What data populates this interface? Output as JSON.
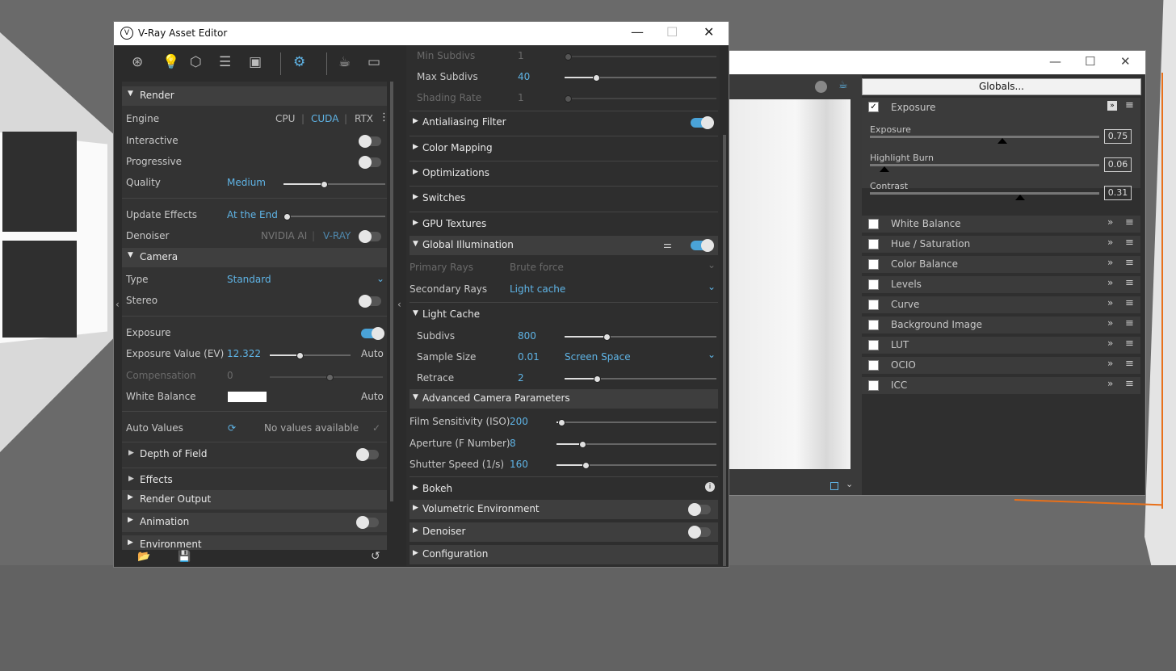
{
  "asset_editor": {
    "title": "V-Ray Asset Editor",
    "render": {
      "header": "Render",
      "engine_label": "Engine",
      "engine_options": [
        "CPU",
        "CUDA",
        "RTX"
      ],
      "interactive_label": "Interactive",
      "progressive_label": "Progressive",
      "quality_label": "Quality",
      "quality_value": "Medium",
      "update_effects_label": "Update Effects",
      "update_effects_value": "At the End",
      "denoiser_label": "Denoiser",
      "denoiser_options": [
        "NVIDIA AI",
        "V-RAY"
      ]
    },
    "camera": {
      "header": "Camera",
      "type_label": "Type",
      "type_value": "Standard",
      "stereo_label": "Stereo",
      "exposure_label": "Exposure",
      "exposure_value_label": "Exposure Value (EV)",
      "exposure_value": "12.322",
      "exposure_auto": "Auto",
      "compensation_label": "Compensation",
      "compensation_value": "0",
      "white_balance_label": "White Balance",
      "white_balance_auto": "Auto",
      "auto_values_label": "Auto Values",
      "auto_values_text": "No values available",
      "white_balance_color": "#ffffff"
    },
    "sections": {
      "depth_of_field": "Depth of Field",
      "effects": "Effects",
      "render_output": "Render Output",
      "animation": "Animation",
      "environment": "Environment"
    },
    "right": {
      "min_subdivs_label": "Min Subdivs",
      "min_subdivs_value": "1",
      "max_subdivs_label": "Max Subdivs",
      "max_subdivs_value": "40",
      "shading_rate_label": "Shading Rate",
      "shading_rate_value": "1",
      "antialiasing": "Antialiasing Filter",
      "color_mapping": "Color Mapping",
      "optimizations": "Optimizations",
      "switches": "Switches",
      "gpu_textures": "GPU Textures",
      "global_illumination": "Global Illumination",
      "primary_rays_label": "Primary Rays",
      "primary_rays_value": "Brute force",
      "secondary_rays_label": "Secondary Rays",
      "secondary_rays_value": "Light cache",
      "light_cache": "Light Cache",
      "subdivs_label": "Subdivs",
      "subdivs_value": "800",
      "sample_size_label": "Sample Size",
      "sample_size_value": "0.01",
      "sample_size_mode": "Screen Space",
      "retrace_label": "Retrace",
      "retrace_value": "2",
      "advanced_camera": "Advanced Camera Parameters",
      "film_label": "Film Sensitivity (ISO)",
      "film_value": "200",
      "aperture_label": "Aperture (F Number)",
      "aperture_value": "8",
      "shutter_label": "Shutter Speed (1/s)",
      "shutter_value": "160",
      "bokeh": "Bokeh",
      "volumetric": "Volumetric Environment",
      "denoiser": "Denoiser",
      "configuration": "Configuration"
    }
  },
  "frame_buffer": {
    "globals_label": "Globals...",
    "exposure_header": "Exposure",
    "exposure_label": "Exposure",
    "exposure_value": "0.75",
    "highlight_label": "Highlight Burn",
    "highlight_value": "0.06",
    "contrast_label": "Contrast",
    "contrast_value": "0.31",
    "layers": [
      "White Balance",
      "Hue / Saturation",
      "Color Balance",
      "Levels",
      "Curve",
      "Background Image",
      "LUT",
      "OCIO",
      "ICC"
    ]
  },
  "colors": {
    "accent": "#5fb4e6",
    "orange_frame": "#e8701a"
  }
}
